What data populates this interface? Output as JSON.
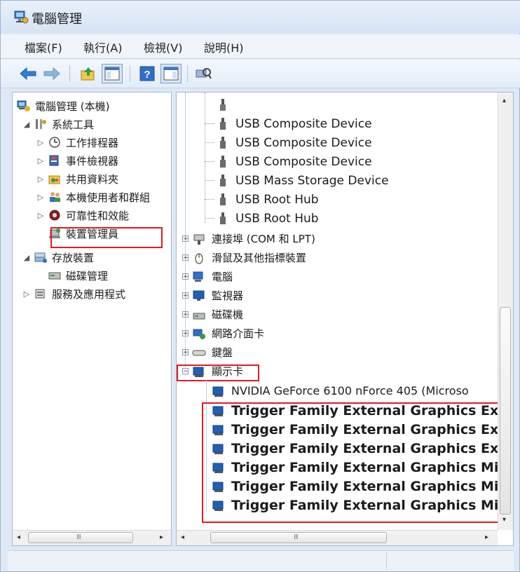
{
  "window": {
    "title": "電腦管理"
  },
  "menu": [
    "檔案(F)",
    "執行(A)",
    "檢視(V)",
    "說明(H)"
  ],
  "toolbar": {
    "buttons": [
      "back-arrow-icon",
      "forward-arrow-icon",
      "up-folder-icon",
      "show-hide-tree-icon",
      "help-icon",
      "properties-icon",
      "scan-hardware-icon"
    ]
  },
  "left_tree": {
    "root": "電腦管理 (本機)",
    "system_tools": "系統工具",
    "items": [
      "工作排程器",
      "事件檢視器",
      "共用資料夾",
      "本機使用者和群組",
      "可靠性和效能",
      "裝置管理員"
    ],
    "storage": "存放裝置",
    "disk_mgmt": "磁碟管理",
    "services": "服務及應用程式"
  },
  "right_tree": {
    "usb_items": [
      "USB Composite Device",
      "USB Composite Device",
      "USB Composite Device",
      "USB Mass Storage Device",
      "USB Root Hub",
      "USB Root Hub"
    ],
    "categories": [
      "連接埠 (COM 和 LPT)",
      "滑鼠及其他指標裝置",
      "電腦",
      "監視器",
      "磁碟機",
      "網路介面卡",
      "鍵盤",
      "顯示卡"
    ],
    "display_adapters": [
      "NVIDIA GeForce 6100 nForce 405 (Microso",
      "Trigger Family External Graphics Extend",
      "Trigger Family External Graphics Extend",
      "Trigger Family External Graphics Extend",
      "Trigger Family External Graphics Mirror",
      "Trigger Family External Graphics Mirror",
      "Trigger Family External Graphics Mirror"
    ]
  },
  "scrollbar": {
    "grip": "III"
  },
  "colors": {
    "highlight_border": "#e11b22",
    "title_bar": "#d6e3f3"
  }
}
